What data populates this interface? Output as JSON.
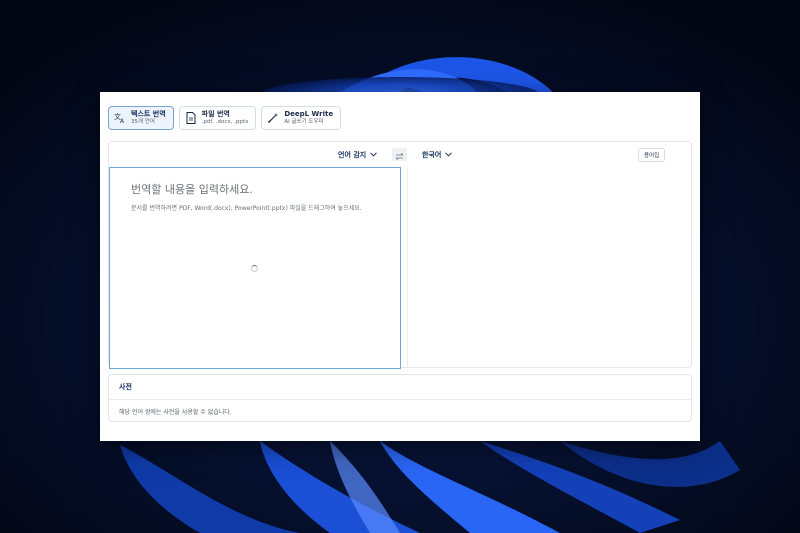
{
  "tabs": [
    {
      "label": "텍스트 번역",
      "sub": "35개 언어",
      "icon": "translate-icon",
      "active": true
    },
    {
      "label": "파일 번역",
      "sub": ".pdf, .docx, .pptx",
      "icon": "document-icon",
      "active": false
    },
    {
      "label": "DeepL Write",
      "sub": "AI 글쓰기 도우미",
      "icon": "pen-sparkle-icon",
      "active": false
    }
  ],
  "translator": {
    "source_lang": "언어 감지",
    "target_lang": "한국어",
    "glossary_label": "용어집",
    "source_placeholder": "번역할 내용을 입력하세요.",
    "source_hint": "문서를 번역하려면 PDF, Word(.docx), PowerPoint(.pptx) 파일을 드래그하여 놓으세요."
  },
  "dictionary": {
    "title": "사전",
    "message": "해당 언어 쌍에는 사전을 사용할 수 없습니다."
  },
  "colors": {
    "accent": "#0f2b5b",
    "focus_border": "#6fa6d9",
    "wallpaper_blue": "#1a4fd6"
  }
}
